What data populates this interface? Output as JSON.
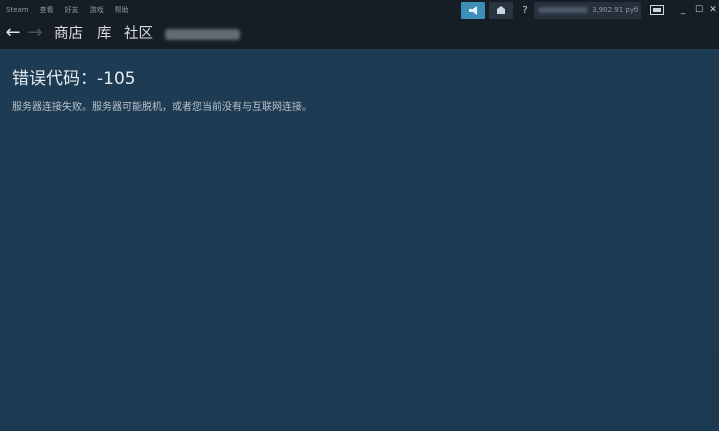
{
  "menubar": {
    "items": [
      "Steam",
      "查看",
      "好友",
      "游戏",
      "帮助"
    ]
  },
  "nav": {
    "back_icon": "arrow-left-icon",
    "forward_icon": "arrow-right-icon",
    "store": "商店",
    "library": "库",
    "community": "社区"
  },
  "header": {
    "broadcast_icon": "megaphone-icon",
    "notification_icon": "envelope-icon",
    "help": "?",
    "balance": "3,902.91 руб",
    "bigpicture_icon": "controller-icon",
    "window": {
      "minimize": "_",
      "maximize": "☐",
      "close": "✕"
    }
  },
  "error": {
    "title": "错误代码：-105",
    "description": "服务器连接失败。服务器可能脱机，或者您当前没有与互联网连接。"
  },
  "colors": {
    "topbar": "#171d25",
    "content": "#1b3a52",
    "accent": "#3d8fb8"
  }
}
